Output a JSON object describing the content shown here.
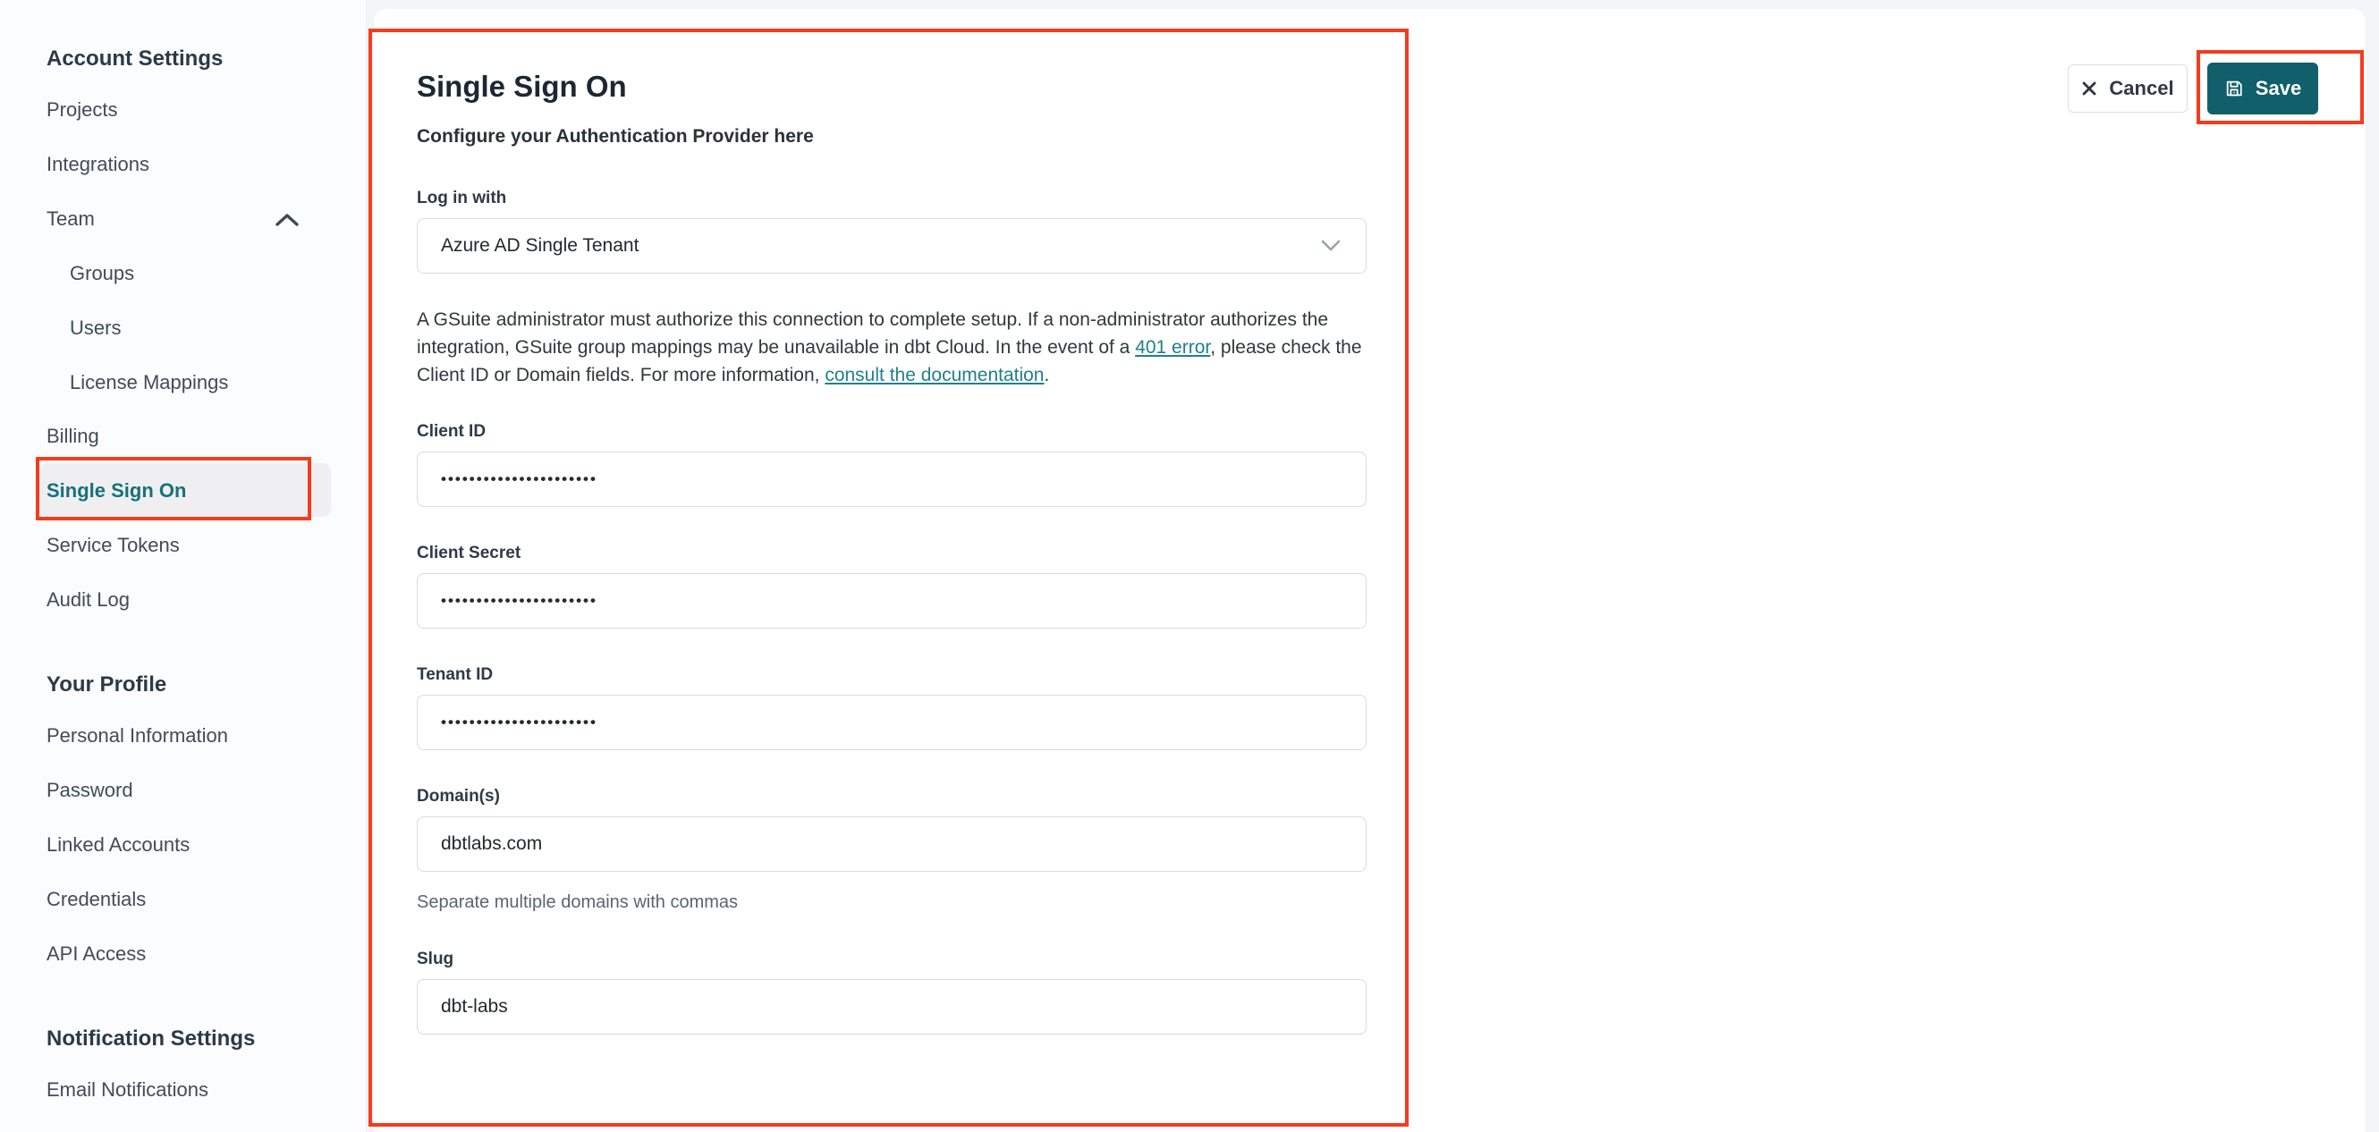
{
  "sidebar": {
    "sections": [
      {
        "heading": "Account Settings",
        "items": [
          {
            "label": "Projects"
          },
          {
            "label": "Integrations"
          },
          {
            "label": "Team"
          },
          {
            "label": "Groups"
          },
          {
            "label": "Users"
          },
          {
            "label": "License Mappings"
          },
          {
            "label": "Billing"
          },
          {
            "label": "Single Sign On"
          },
          {
            "label": "Service Tokens"
          },
          {
            "label": "Audit Log"
          }
        ]
      },
      {
        "heading": "Your Profile",
        "items": [
          {
            "label": "Personal Information"
          },
          {
            "label": "Password"
          },
          {
            "label": "Linked Accounts"
          },
          {
            "label": "Credentials"
          },
          {
            "label": "API Access"
          }
        ]
      },
      {
        "heading": "Notification Settings",
        "items": [
          {
            "label": "Email Notifications"
          }
        ]
      }
    ],
    "selected_item": "Single Sign On"
  },
  "page": {
    "title": "Single Sign On",
    "subtitle": "Configure your Authentication Provider here"
  },
  "form": {
    "login_with": {
      "label": "Log in with",
      "value": "Azure AD Single Tenant"
    },
    "info": {
      "part1": "A GSuite administrator must authorize this connection to complete setup. If a non-administrator authorizes the integration, GSuite group mappings may be unavailable in dbt Cloud. In the event of a ",
      "link1": "401 error",
      "part2": ", please check the Client ID or Domain fields. For more information, ",
      "link2": "consult the documentation",
      "part3": "."
    },
    "client_id": {
      "label": "Client ID",
      "value": "••••••••••••••••••••••"
    },
    "client_secret": {
      "label": "Client Secret",
      "value": "••••••••••••••••••••••"
    },
    "tenant_id": {
      "label": "Tenant ID",
      "value": "••••••••••••••••••••••"
    },
    "domains": {
      "label": "Domain(s)",
      "value": "dbtlabs.com",
      "helper": "Separate multiple domains with commas"
    },
    "slug": {
      "label": "Slug",
      "value": "dbt-labs"
    }
  },
  "toolbar": {
    "cancel_label": "Cancel",
    "save_label": "Save"
  },
  "colors": {
    "save_button_teal": "#105f6b",
    "link_teal": "#1f808c",
    "selected_item_teal": "#17707a",
    "annotation_red": "#f53b1d",
    "page_background": "#f3f5f7",
    "panel_background": "#ffffff"
  }
}
